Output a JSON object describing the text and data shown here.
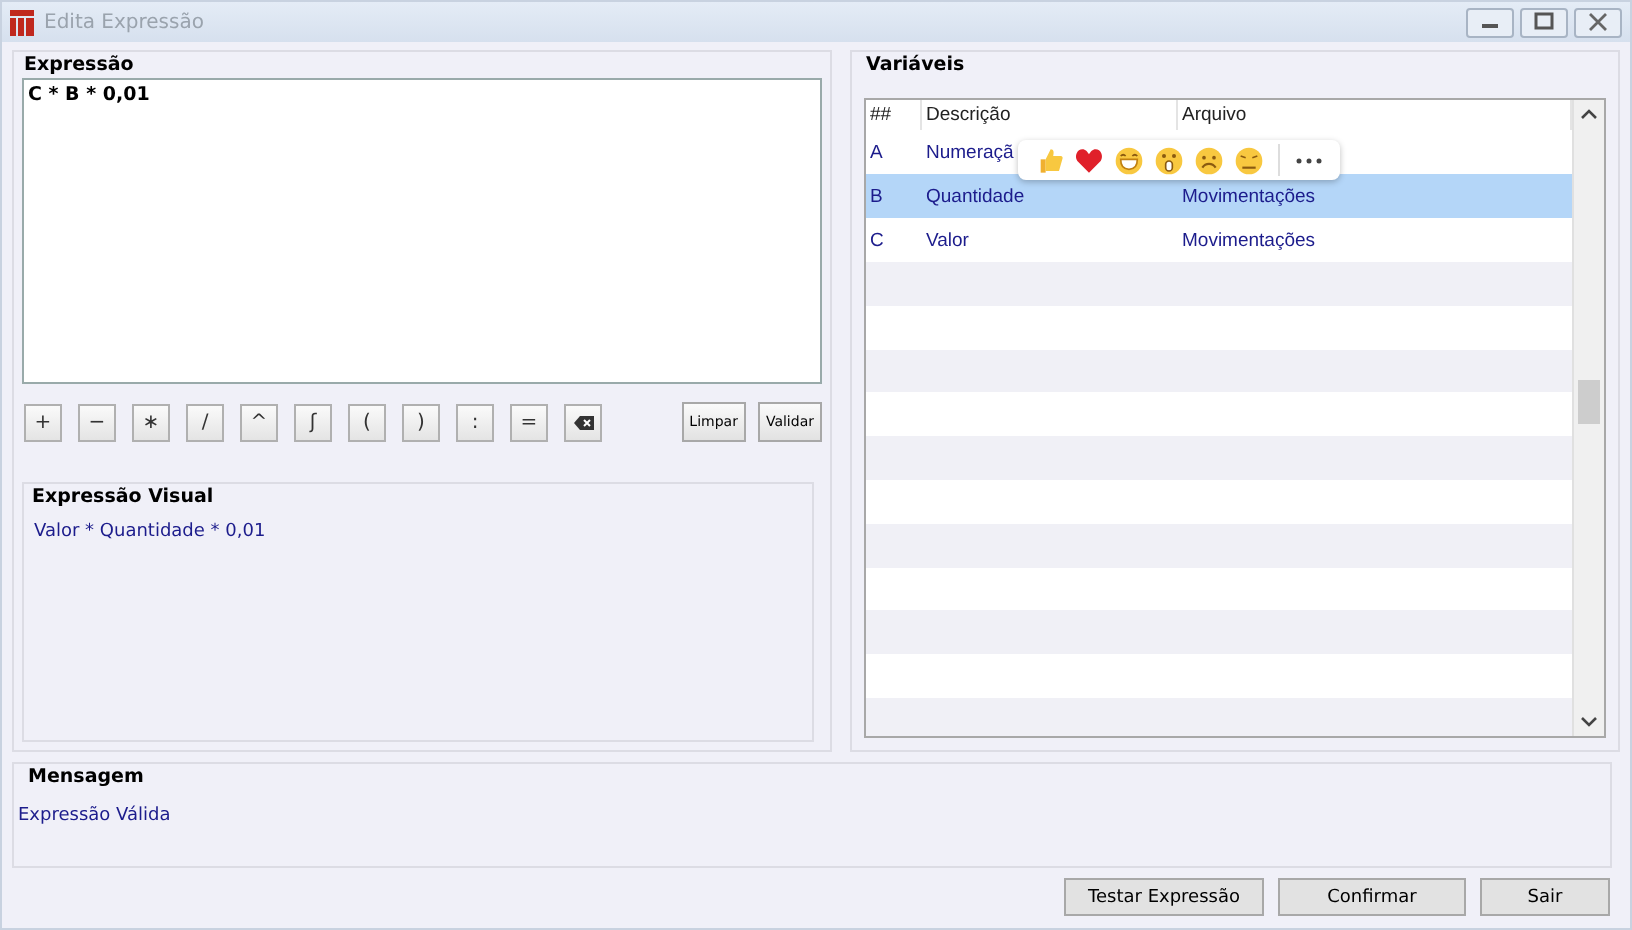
{
  "window": {
    "title": "Edita Expressão",
    "active": false
  },
  "expression": {
    "title": "Expressão",
    "value": "C * B * 0,01"
  },
  "operators": [
    {
      "kind": "text",
      "label": "+"
    },
    {
      "kind": "text",
      "label": "−"
    },
    {
      "kind": "text",
      "label": "∗"
    },
    {
      "kind": "text",
      "label": "/"
    },
    {
      "kind": "text",
      "label": "^"
    },
    {
      "kind": "text",
      "label": "ʃ"
    },
    {
      "kind": "text",
      "label": "("
    },
    {
      "kind": "text",
      "label": ")"
    },
    {
      "kind": "text",
      "label": ":"
    },
    {
      "kind": "text",
      "label": "="
    },
    {
      "kind": "backspace"
    }
  ],
  "actions": [
    "Limpar",
    "Validar"
  ],
  "visual": {
    "title": "Expressão Visual",
    "text": "Valor * Quantidade * 0,01"
  },
  "variables": {
    "title": "Variáveis",
    "columns": [
      "##",
      "Descrição",
      "Arquivo"
    ],
    "rows": [
      {
        "cells": [
          "A",
          "Numeraçã"
        ],
        "selected": false
      },
      {
        "cells": [
          "B",
          "Quantidade",
          "Movimentações"
        ],
        "selected": true
      },
      {
        "cells": [
          "C",
          "Valor",
          "Movimentações"
        ],
        "selected": false
      }
    ]
  },
  "message": {
    "title": "Mensagem",
    "text": "Expressão Válida"
  },
  "buttons": [
    "Testar Expressão",
    "Confirmar",
    "Sair"
  ]
}
